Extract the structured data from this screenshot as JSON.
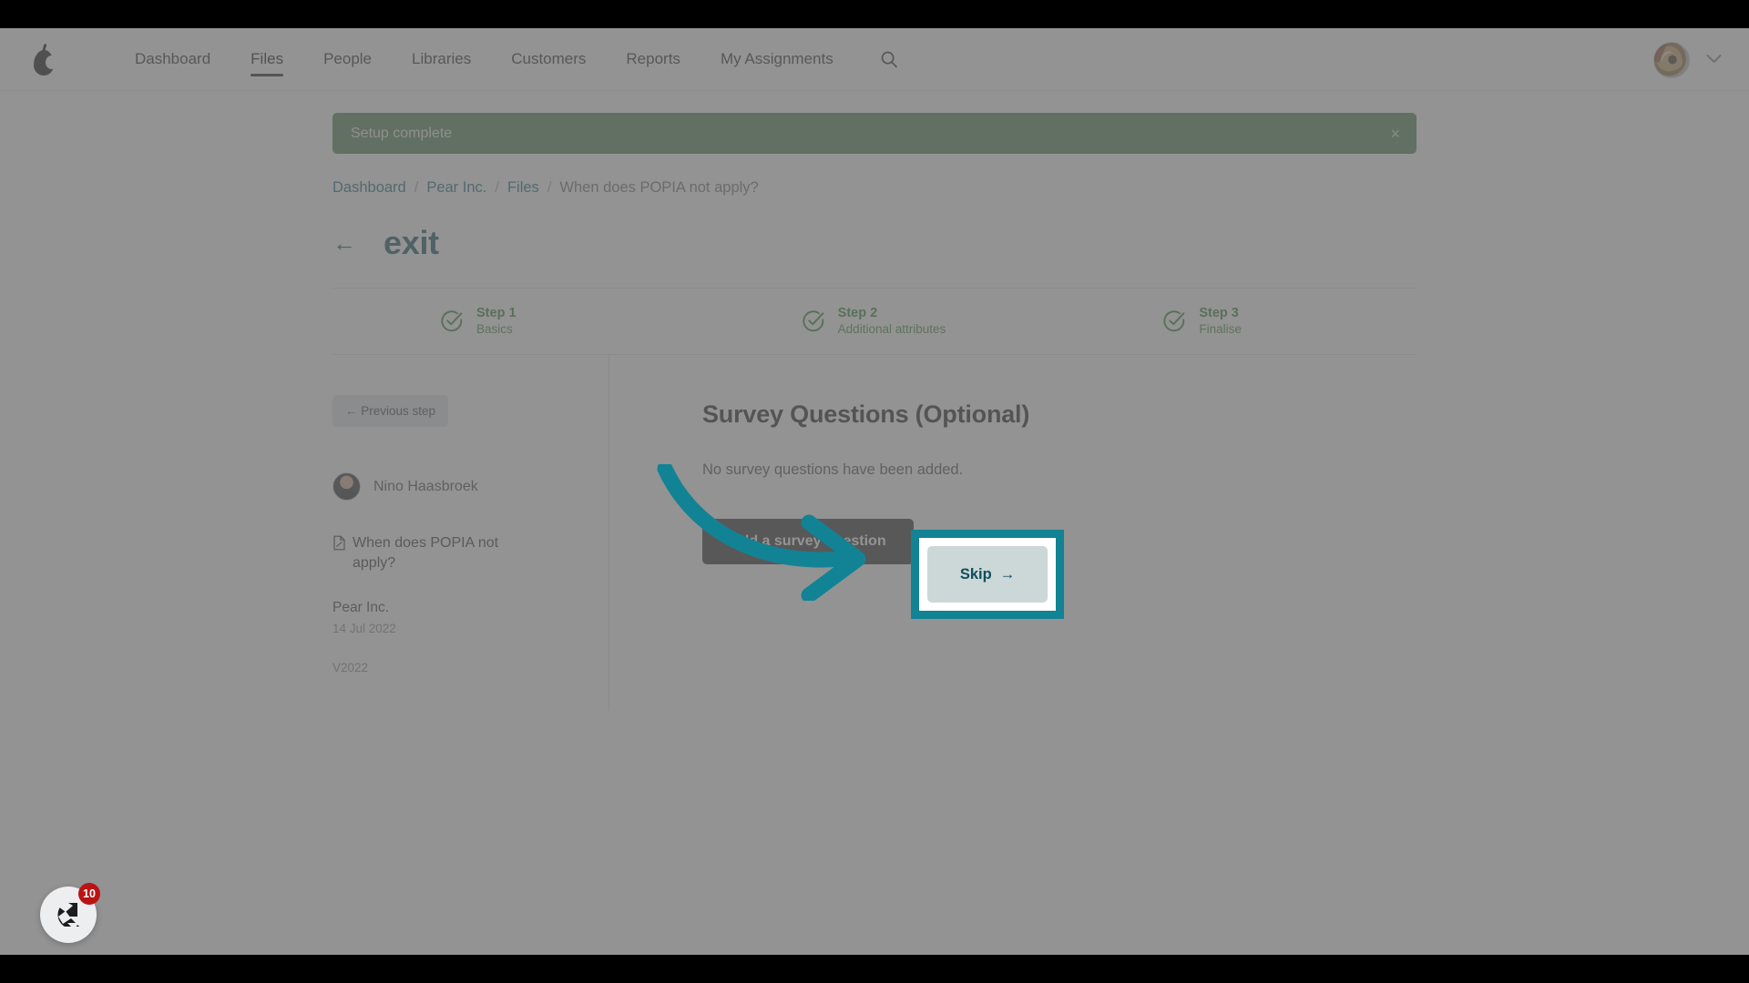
{
  "nav": {
    "logo_icon": "pear-logo-icon",
    "links": [
      {
        "label": "Dashboard",
        "active": false
      },
      {
        "label": "Files",
        "active": true
      },
      {
        "label": "People",
        "active": false
      },
      {
        "label": "Libraries",
        "active": false
      },
      {
        "label": "Customers",
        "active": false
      },
      {
        "label": "Reports",
        "active": false
      },
      {
        "label": "My Assignments",
        "active": false
      }
    ],
    "search_icon": "search-icon",
    "avatar_icon": "user-avatar-dog-photo",
    "chevron_icon": "chevron-down-icon"
  },
  "flash": {
    "message": "Setup complete",
    "close_label": "×",
    "background": "#4f7f52"
  },
  "breadcrumb": {
    "items": [
      "Dashboard",
      "Pear Inc.",
      "Files"
    ],
    "separator": "/",
    "current": "When does POPIA not apply?",
    "link_color": "#17697a"
  },
  "header": {
    "back_arrow": "←",
    "title": "exit",
    "title_color": "#0c4f5c"
  },
  "steps": [
    {
      "name": "Step 1",
      "sub": "Basics",
      "state": "complete"
    },
    {
      "name": "Step 2",
      "sub": "Additional attributes",
      "state": "complete"
    },
    {
      "name": "Step 3",
      "sub": "Finalise",
      "state": "complete"
    }
  ],
  "step_color": "#2f7d31",
  "sidebar": {
    "previous_step_label": "← Previous step",
    "person_name": "Nino Haasbroek",
    "document_title": "When does POPIA not apply?",
    "document_icon": "file-document-icon",
    "organisation": "Pear Inc.",
    "date": "14 Jul 2022",
    "version": "V2022"
  },
  "main": {
    "title": "Survey Questions (Optional)",
    "empty_message": "No survey questions have been added.",
    "add_question_label": "Add a survey question",
    "skip_label": "Skip",
    "skip_arrow": "→"
  },
  "highlight": {
    "color": "#128394",
    "target": "skip-button"
  },
  "widget": {
    "icon": "chameleon-chat-icon",
    "badge_count": "10",
    "badge_color": "#bb1313"
  }
}
